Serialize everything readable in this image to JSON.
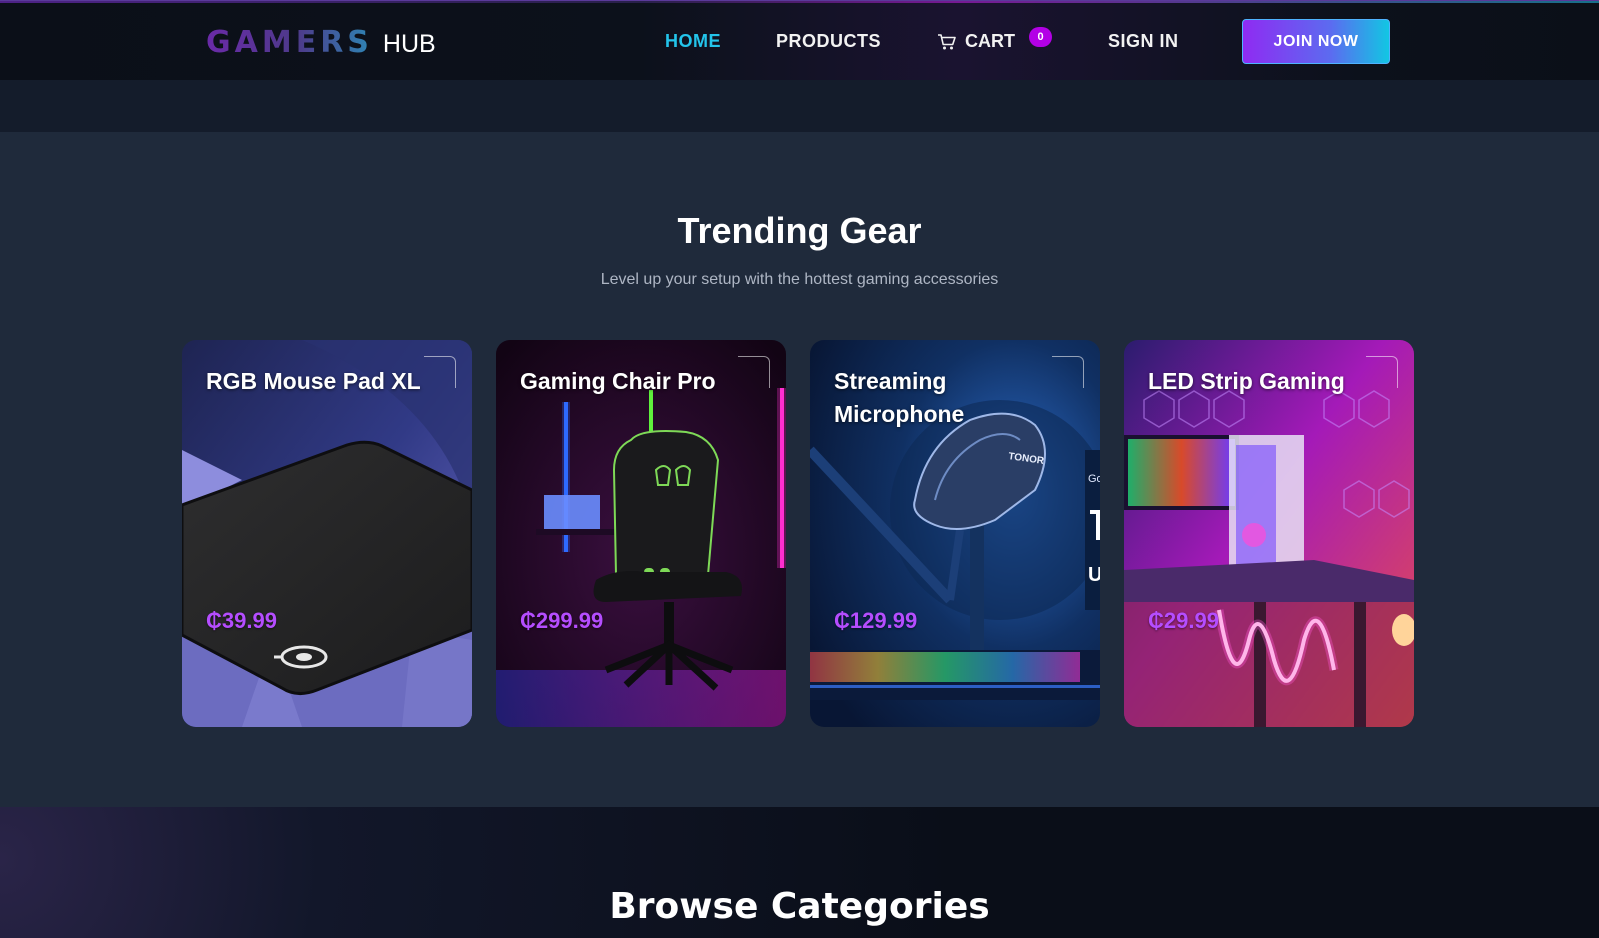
{
  "header": {
    "logo_main": "GAMERS",
    "logo_sub": "HUB",
    "nav": {
      "home": "HOME",
      "products": "PRODUCTS",
      "cart": "CART",
      "cart_count": "0",
      "sign_in": "SIGN IN",
      "join": "JOIN NOW"
    },
    "accent_color": "#23c4ea",
    "badge_color": "#b300e6"
  },
  "trending": {
    "title": "Trending Gear",
    "subtitle": "Level up your setup with the hottest gaming accessories",
    "products": [
      {
        "name": "RGB Mouse Pad XL",
        "price": "₵39.99",
        "image": "mouse-pad"
      },
      {
        "name": "Gaming Chair Pro",
        "price": "₵299.99",
        "image": "gaming-chair"
      },
      {
        "name": "Streaming Microphone",
        "price": "₵129.99",
        "image": "microphone"
      },
      {
        "name": "LED Strip Gaming",
        "price": "₵29.99",
        "image": "led-desk"
      }
    ],
    "price_color": "#b54dff"
  },
  "categories": {
    "title": "Browse Categories"
  }
}
